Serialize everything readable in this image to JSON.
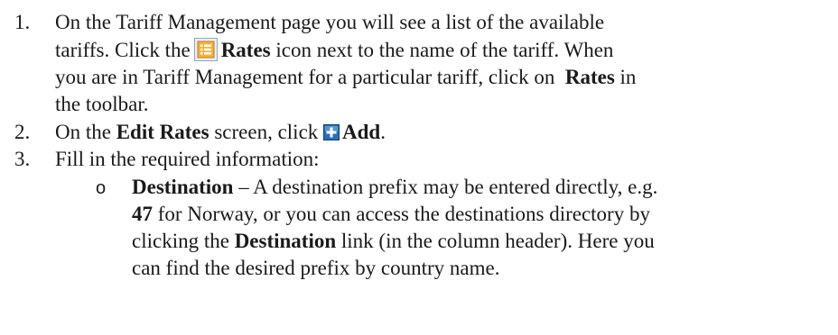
{
  "steps": [
    {
      "number": "1.",
      "line1_a": "On the Tariff Management page you will see a list of the available",
      "line2_a": "tariffs. Click the",
      "line2_bold": "Rates",
      "line2_b": "icon next to the name of the tariff. When",
      "line3": "you are in Tariff Management for a particular tariff, click on",
      "line3_bold": "Rates",
      "line3_b": "in",
      "line4": "the toolbar."
    },
    {
      "number": "2.",
      "a": "On the",
      "bold1": "Edit Rates",
      "b": "screen, click",
      "bold2": "Add",
      "c": "."
    },
    {
      "number": "3.",
      "text": "Fill in the required information:"
    }
  ],
  "sub_item": {
    "bullet": "o",
    "bold1": "Destination",
    "line1_a": "– A destination prefix may be entered directly, e.g.",
    "line2_bold": "47",
    "line2_a": "for Norway, or you can access the destinations directory by",
    "line3_a": "clicking the",
    "line3_bold": "Destination",
    "line3_b": "link (in the column header). Here you",
    "line4": "can find the desired prefix by country name."
  },
  "icons": {
    "rates_icon": "rates-list-icon",
    "add_icon": "add-plus-icon",
    "rates_icon_color": "#f0a020",
    "add_icon_color": "#2a6fb8"
  }
}
